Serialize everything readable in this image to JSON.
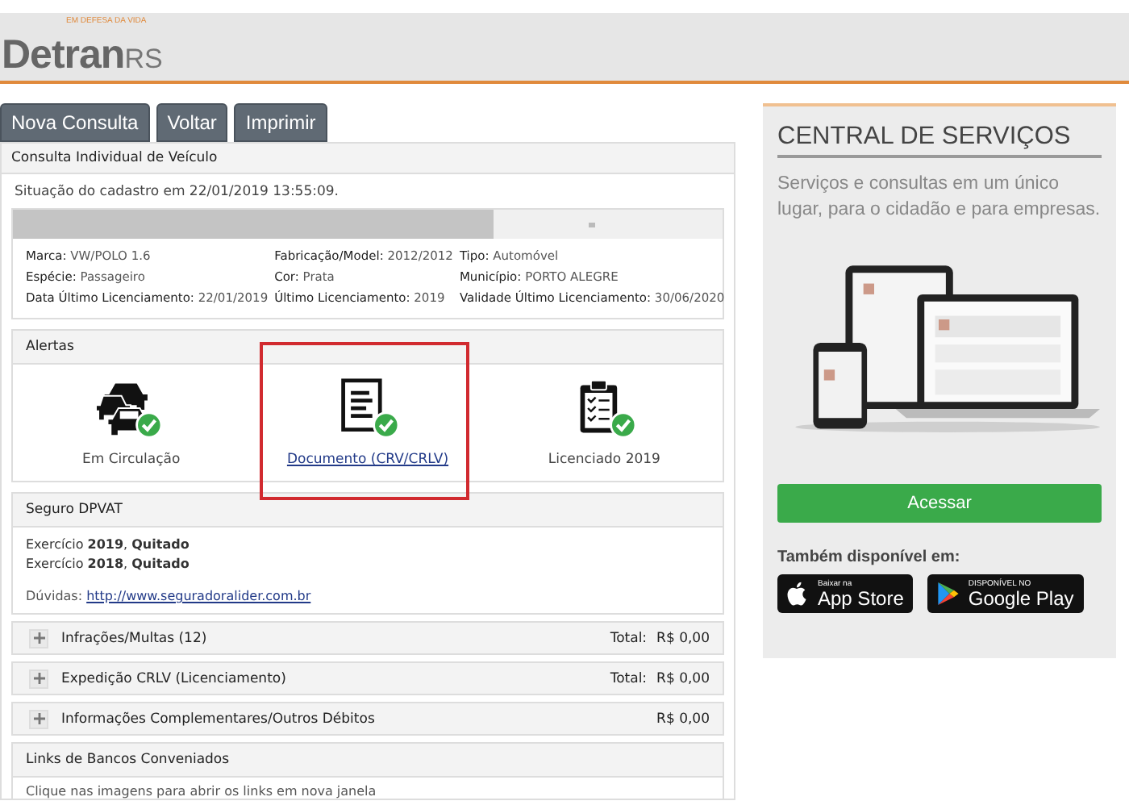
{
  "header": {
    "logo_tagline": "EM DEFESA DA VIDA",
    "logo_main": "Detran",
    "logo_suffix": "RS"
  },
  "actions": [
    "Nova Consulta",
    "Voltar",
    "Imprimir"
  ],
  "consulta": {
    "title": "Consulta Individual de Veículo",
    "situacao": "Situação do cadastro em 22/01/2019 13:55:09.",
    "fields": [
      {
        "label": "Marca:",
        "value": "VW/POLO 1.6"
      },
      {
        "label": "Fabricação/Model:",
        "value": "2012/2012"
      },
      {
        "label": "Tipo:",
        "value": "Automóvel"
      },
      {
        "label": "Espécie:",
        "value": "Passageiro"
      },
      {
        "label": "Cor:",
        "value": "Prata"
      },
      {
        "label": "Município:",
        "value": "PORTO ALEGRE"
      },
      {
        "label": "Data Último Licenciamento:",
        "value": "22/01/2019"
      },
      {
        "label": "Último Licenciamento:",
        "value": "2019"
      },
      {
        "label": "Validade Último Licenciamento:",
        "value": "30/06/2020"
      }
    ]
  },
  "alertas": {
    "title": "Alertas",
    "items": [
      {
        "kind": "cars",
        "label": "Em Circulação",
        "link": false,
        "ok": true,
        "highlighted": false
      },
      {
        "kind": "document",
        "label": "Documento (CRV/CRLV)",
        "link": true,
        "ok": true,
        "highlighted": true
      },
      {
        "kind": "clipboard",
        "label": "Licenciado 2019",
        "link": false,
        "ok": true,
        "highlighted": false
      }
    ]
  },
  "dpvat": {
    "title": "Seguro DPVAT",
    "lines": [
      "Exercício **2019**, **Quitado**",
      "Exercício **2018**, **Quitado**"
    ],
    "duvidas_label": "Dúvidas:",
    "duvidas_link": "http://www.seguradoralider.com.br"
  },
  "sections": [
    {
      "title": "Infrações/Multas (12)",
      "total_label": "Total:",
      "total": "R$ 0,00",
      "expanded": false
    },
    {
      "title": "Expedição CRLV (Licenciamento)",
      "total_label": "Total:",
      "total": "R$ 0,00",
      "expanded": false
    },
    {
      "title": "Informações Complementares/Outros Débitos",
      "total": "R$ 0,00",
      "expanded": false
    }
  ],
  "bancos": {
    "title": "Links de Bancos Conveniados",
    "hint": "Clique nas imagens para abrir os links em nova janela"
  },
  "central": {
    "title": "CENTRAL DE SERVIÇOS",
    "description": "Serviços e consultas em um único lugar, para o cidadão e para empresas.",
    "button": "Acessar",
    "also": "Também disponível em:",
    "stores": [
      {
        "kind": "apple",
        "small": "Baixar na",
        "big": "App Store"
      },
      {
        "kind": "google",
        "small": "DISPONÍVEL NO",
        "big": "Google Play"
      }
    ]
  }
}
